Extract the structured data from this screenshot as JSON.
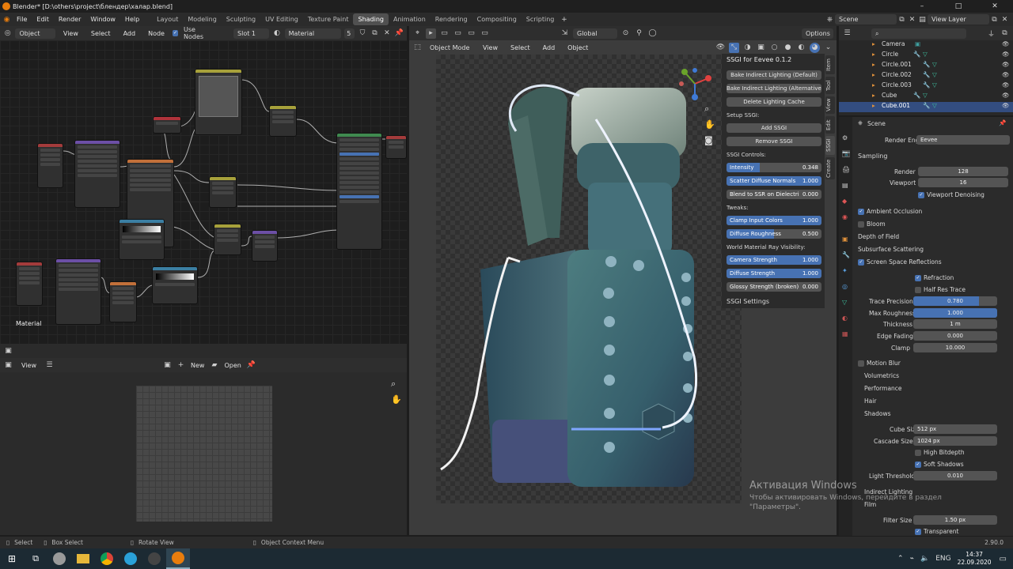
{
  "window": {
    "title": "Blender* [D:\\others\\project\\блендер\\халар.blend]",
    "controls": [
      "–",
      "□",
      "✕"
    ]
  },
  "menu": [
    "File",
    "Edit",
    "Render",
    "Window",
    "Help"
  ],
  "workspaces": [
    "Layout",
    "Modeling",
    "Sculpting",
    "UV Editing",
    "Texture Paint",
    "Shading",
    "Animation",
    "Rendering",
    "Compositing",
    "Scripting"
  ],
  "active_workspace": "Shading",
  "scene_name": "Scene",
  "view_layer": "View Layer",
  "node_editor": {
    "object_dropdown": "Object",
    "menus": [
      "View",
      "Select",
      "Add",
      "Node"
    ],
    "use_nodes_label": "Use Nodes",
    "slot": "Slot 1",
    "material": "Material",
    "material_users": "5",
    "material_name_label": "Material"
  },
  "viewport": {
    "mode": "Object Mode",
    "menus": [
      "View",
      "Select",
      "Add",
      "Object"
    ],
    "orientation": "Global",
    "options_label": "Options"
  },
  "ssgi": {
    "title": "SSGI for Eevee 0.1.2",
    "bake_default": "Bake Indirect Lighting (Default)",
    "bake_alt": "Bake Indirect Lighting (Alternative)",
    "delete_cache": "Delete Lighting Cache",
    "setup_label": "Setup SSGI:",
    "add": "Add SSGI",
    "remove": "Remove SSGI",
    "controls_label": "SSGI Controls:",
    "controls": [
      {
        "label": "Intensity",
        "value": "0.348",
        "fraction": 0.348
      },
      {
        "label": "Scatter Diffuse Normals",
        "value": "1.000",
        "fraction": 1.0
      },
      {
        "label": "Blend to SSR on Dielectri",
        "value": "0.000",
        "fraction": 0.0
      }
    ],
    "tweaks_label": "Tweaks:",
    "tweaks": [
      {
        "label": "Clamp Input Colors",
        "value": "1.000",
        "fraction": 1.0
      },
      {
        "label": "Diffuse Roughness",
        "value": "0.500",
        "fraction": 0.5
      }
    ],
    "ray_label": "World Material Ray Visibility:",
    "ray": [
      {
        "label": "Camera Strength",
        "value": "1.000",
        "fraction": 1.0
      },
      {
        "label": "Diffuse Strength",
        "value": "1.000",
        "fraction": 1.0
      },
      {
        "label": "Glossy Strength (broken)",
        "value": "0.000",
        "fraction": 0.0
      }
    ],
    "settings": "SSGI Settings"
  },
  "side_tabs": [
    "Item",
    "Tool",
    "View",
    "Edit",
    "SSGI",
    "Create"
  ],
  "outliner": {
    "items": [
      "Camera",
      "Circle",
      "Circle.001",
      "Circle.002",
      "Circle.003",
      "Cube",
      "Cube.001"
    ],
    "selected": "Cube.001"
  },
  "properties": {
    "scene": "Scene",
    "render_engine_label": "Render Engine",
    "render_engine": "Eevee",
    "sampling": "Sampling",
    "render_label": "Render",
    "render_value": "128",
    "viewport_label": "Viewport",
    "viewport_value": "16",
    "denoise": "Viewport Denoising",
    "panels": [
      "Ambient Occlusion",
      "Bloom",
      "Depth of Field",
      "Subsurface Scattering",
      "Screen Space Reflections"
    ],
    "refraction": "Refraction",
    "half_res": "Half Res Trace",
    "ssr_fields": [
      {
        "label": "Trace Precision",
        "value": "0.780",
        "fraction": 0.78
      },
      {
        "label": "Max Roughness",
        "value": "1.000",
        "fraction": 1.0
      },
      {
        "label": "Thickness",
        "value": "1 m",
        "fraction": 0
      },
      {
        "label": "Edge Fading",
        "value": "0.000",
        "fraction": 0
      },
      {
        "label": "Clamp",
        "value": "10.000",
        "fraction": 0
      }
    ],
    "panels2": [
      "Motion Blur",
      "Volumetrics",
      "Performance",
      "Hair",
      "Shadows"
    ],
    "cube_size_label": "Cube Size",
    "cube_size": "512 px",
    "cascade_label": "Cascade Size",
    "cascade": "1024 px",
    "high_bitdepth": "High Bitdepth",
    "soft_shadows": "Soft Shadows",
    "light_threshold_label": "Light Threshold",
    "light_threshold": "0.010",
    "indirect": "Indirect Lighting",
    "film": "Film",
    "filter_size_label": "Filter Size",
    "filter_size": "1.50 px",
    "transparent": "Transparent"
  },
  "image_editor": {
    "view": "View",
    "new": "New",
    "open": "Open"
  },
  "status": {
    "select": "Select",
    "box_select": "Box Select",
    "rotate_view": "Rotate View",
    "context_menu": "Object Context Menu",
    "version": "2.90.0"
  },
  "watermark": {
    "line1": "Активация Windows",
    "line2": "Чтобы активировать Windows, перейдите в раздел",
    "line3": "\"Параметры\"."
  },
  "taskbar": {
    "time": "14:37",
    "date": "22.09.2020",
    "lang": "ENG"
  },
  "colors": {
    "accent_blue": "#4772b3",
    "panel": "#2b2b2b",
    "background": "#1d1d1d",
    "taskbar": "#1c2a33"
  }
}
